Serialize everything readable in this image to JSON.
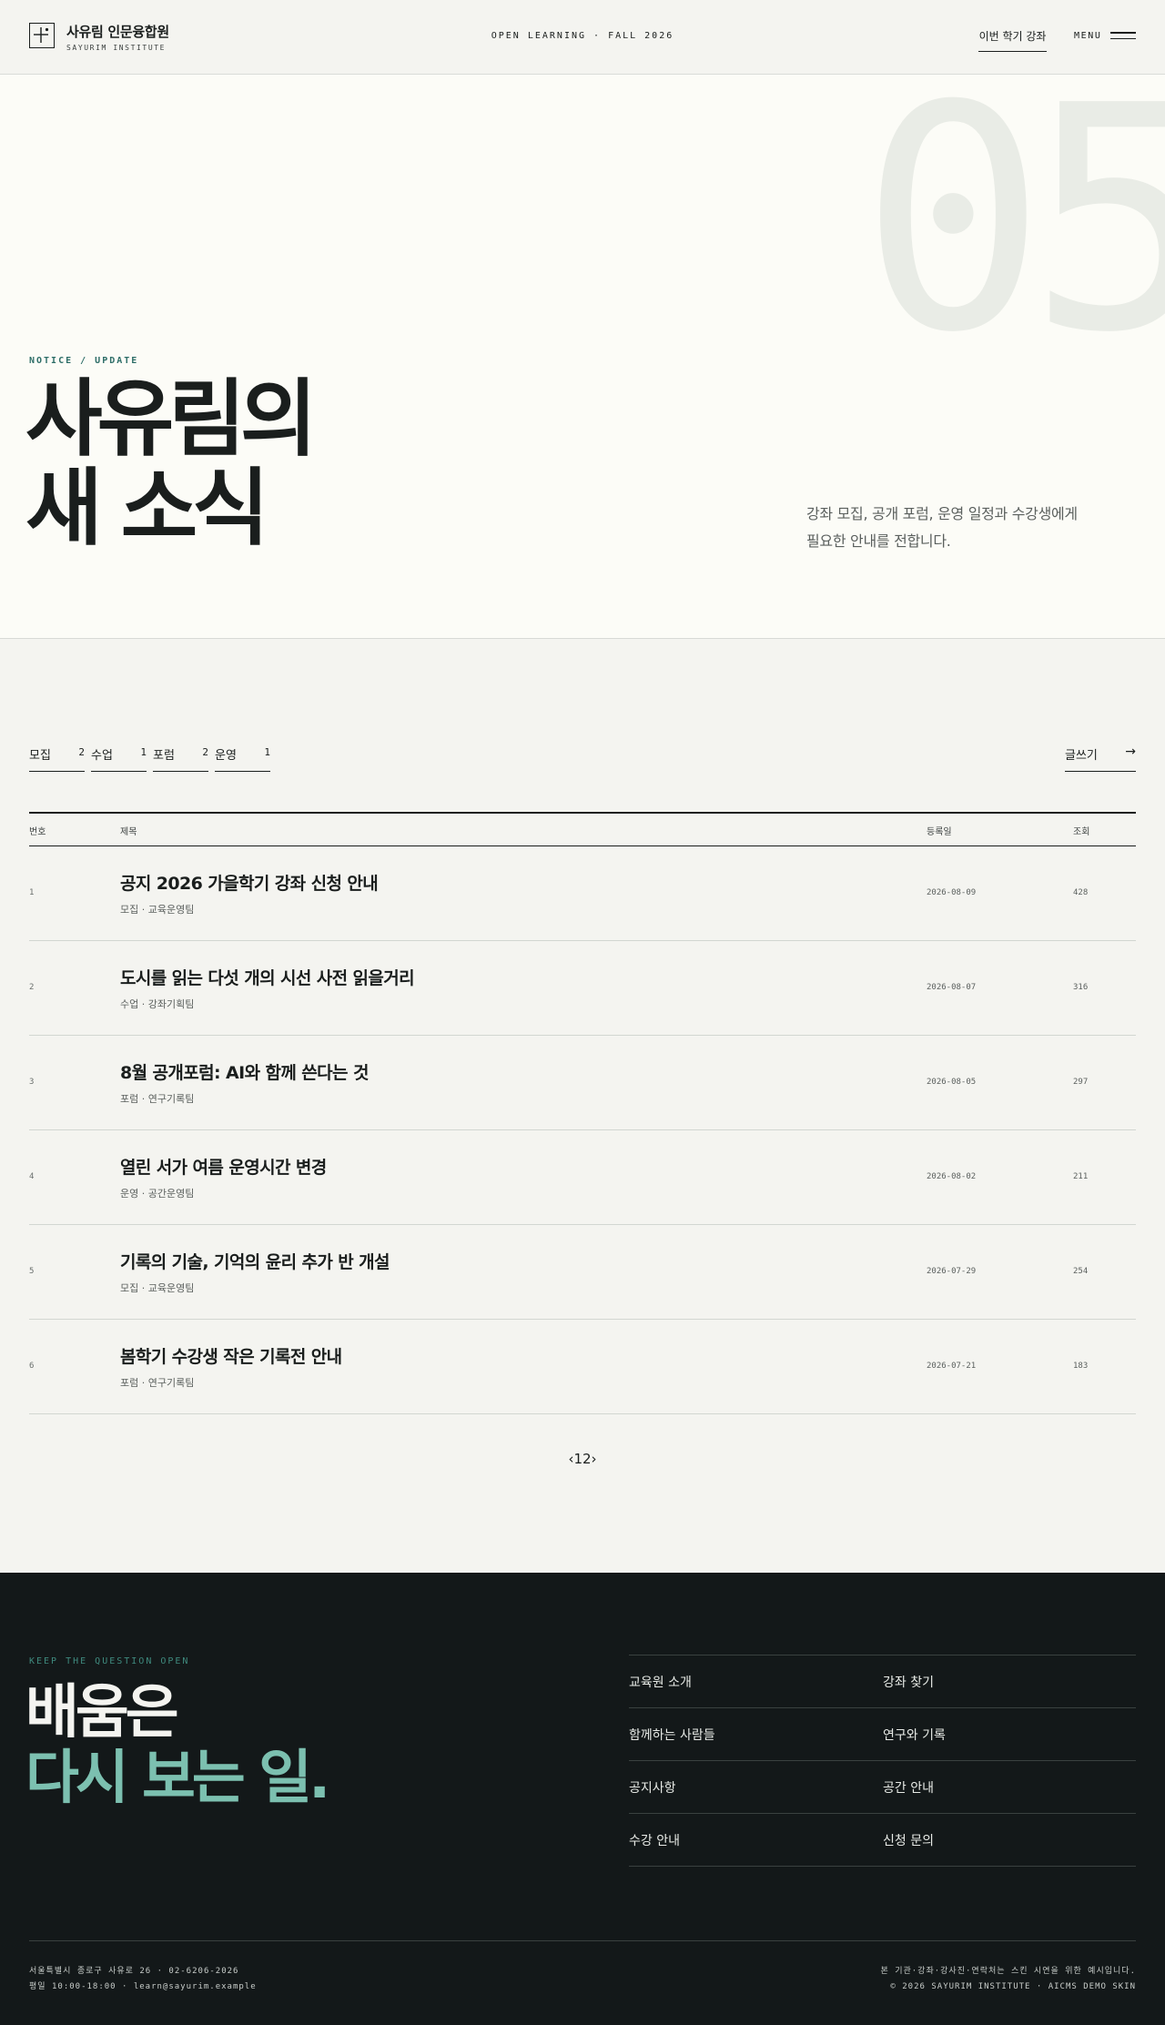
{
  "header": {
    "brand_title": "사유림 인문융합원",
    "brand_sub": "SAYURIM INSTITUTE",
    "center_text": "OPEN LEARNING · FALL 2026",
    "nav_link": "이번 학기 강좌",
    "menu_label": "MENU"
  },
  "hero": {
    "big_number": "05",
    "tag": "NOTICE / UPDATE",
    "title_line1": "사유림의",
    "title_line2": "새 소식",
    "description_line1": "강좌 모집, 공개 포럼, 운영 일정과 수강생에게",
    "description_line2": "필요한 안내를 전합니다."
  },
  "filters": [
    {
      "label": "모집",
      "count": "2"
    },
    {
      "label": "수업",
      "count": "1"
    },
    {
      "label": "포럼",
      "count": "2"
    },
    {
      "label": "운영",
      "count": "1"
    }
  ],
  "write_button": {
    "label": "글쓰기",
    "arrow": "→"
  },
  "table": {
    "headers": {
      "num": "번호",
      "title": "제목",
      "date": "등록일",
      "views": "조회"
    },
    "rows": [
      {
        "num": "1",
        "title": "공지 2026 가을학기 강좌 신청 안내",
        "meta": "모집 · 교육운영팀",
        "date": "2026-08-09",
        "views": "428"
      },
      {
        "num": "2",
        "title": "도시를 읽는 다섯 개의 시선 사전 읽을거리",
        "meta": "수업 · 강좌기획팀",
        "date": "2026-08-07",
        "views": "316"
      },
      {
        "num": "3",
        "title": "8월 공개포럼: AI와 함께 쓴다는 것",
        "meta": "포럼 · 연구기록팀",
        "date": "2026-08-05",
        "views": "297"
      },
      {
        "num": "4",
        "title": "열린 서가 여름 운영시간 변경",
        "meta": "운영 · 공간운영팀",
        "date": "2026-08-02",
        "views": "211"
      },
      {
        "num": "5",
        "title": "기록의 기술, 기억의 윤리 추가 반 개설",
        "meta": "모집 · 교육운영팀",
        "date": "2026-07-29",
        "views": "254"
      },
      {
        "num": "6",
        "title": "봄학기 수강생 작은 기록전 안내",
        "meta": "포럼 · 연구기록팀",
        "date": "2026-07-21",
        "views": "183"
      }
    ]
  },
  "pagination": {
    "text": "‹12›"
  },
  "footer": {
    "tag": "KEEP THE QUESTION OPEN",
    "slogan_line1": "배움은",
    "slogan_line2": "다시 보는 일.",
    "nav": [
      [
        "교육원 소개",
        "강좌 찾기"
      ],
      [
        "함께하는 사람들",
        "연구와 기록"
      ],
      [
        "공지사항",
        "공간 안내"
      ],
      [
        "수강 안내",
        "신청 문의"
      ]
    ],
    "address_line1": "서울특별시 종로구 사유로 26 · 02-6206-2026",
    "address_line2": "평일 10:00-18:00 · learn@sayurim.example",
    "notice_line1": "본 기관·강좌·강사진·연락처는 스킨 시연을 위한 예시입니다.",
    "notice_line2": "© 2026 SAYURIM INSTITUTE · AICMS DEMO SKIN"
  },
  "colors": {
    "accent_teal": "#2e6e68",
    "footer_bg": "#131819",
    "footer_highlight": "#7cc0b0",
    "page_bg": "#f4f4f0",
    "hero_bg": "#fcfcf7"
  }
}
